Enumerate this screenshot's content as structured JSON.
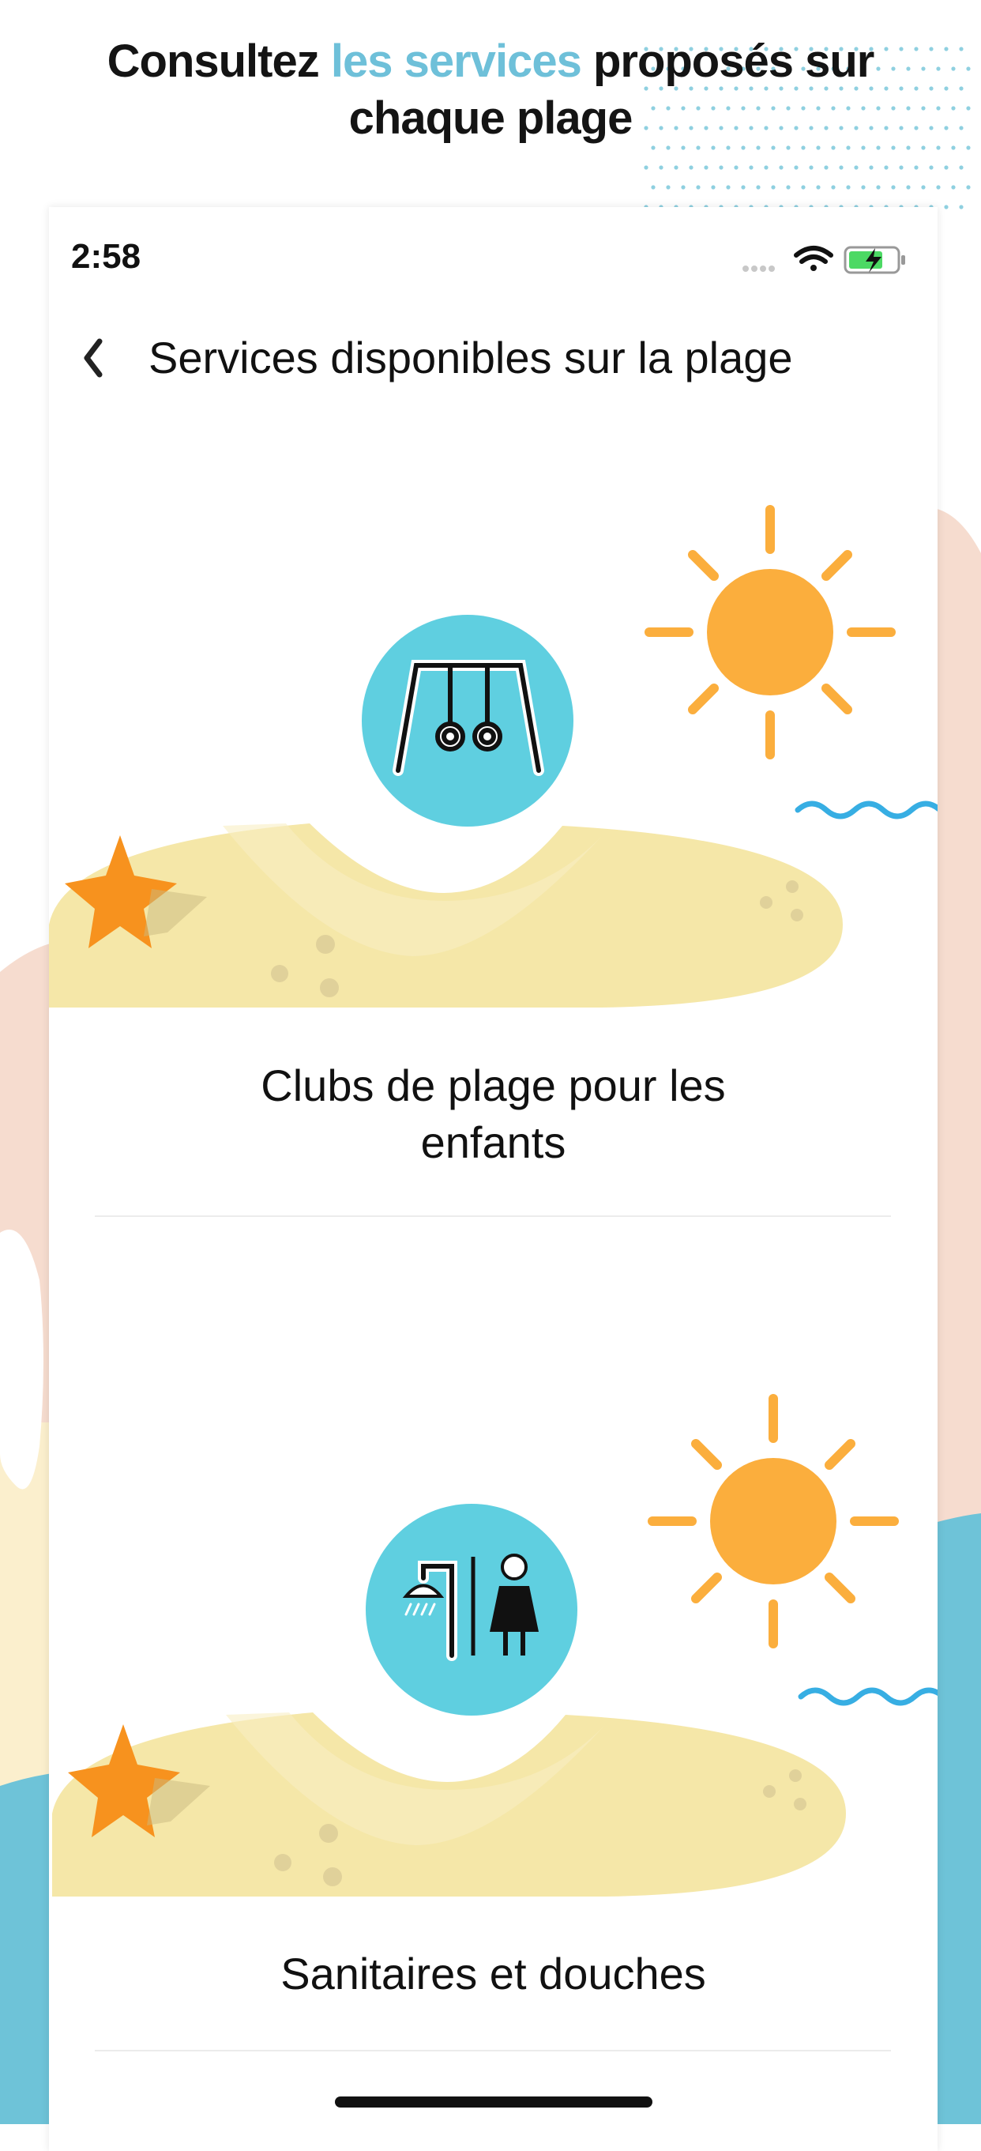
{
  "promo": {
    "headline_part1": "Consultez ",
    "headline_accent": "les services",
    "headline_part2": " proposés sur",
    "headline_line2": "chaque plage",
    "accent_color": "#6ec0d9"
  },
  "status_bar": {
    "time": "2:58",
    "icons": [
      "signal-dots-icon",
      "wifi-icon",
      "battery-charging-icon"
    ]
  },
  "nav": {
    "back_icon": "chevron-left-icon",
    "title": "Services disponibles sur la plage"
  },
  "services": [
    {
      "label_line1": "Clubs de plage pour les",
      "label_line2": "enfants",
      "icon": "swing-rings-icon"
    },
    {
      "label_line1": "Sanitaires et douches",
      "label_line2": "",
      "icon": "shower-toilet-icon"
    }
  ],
  "colors": {
    "icon_circle": "#5fcfe0",
    "sun": "#fbae3d",
    "sand": "#f5e7a8",
    "starfish": "#f7921e",
    "wave": "#37aee3",
    "bg_peach": "#f6dccf",
    "bg_sand": "#fbefcd",
    "bg_sea": "#6ec3d8"
  }
}
